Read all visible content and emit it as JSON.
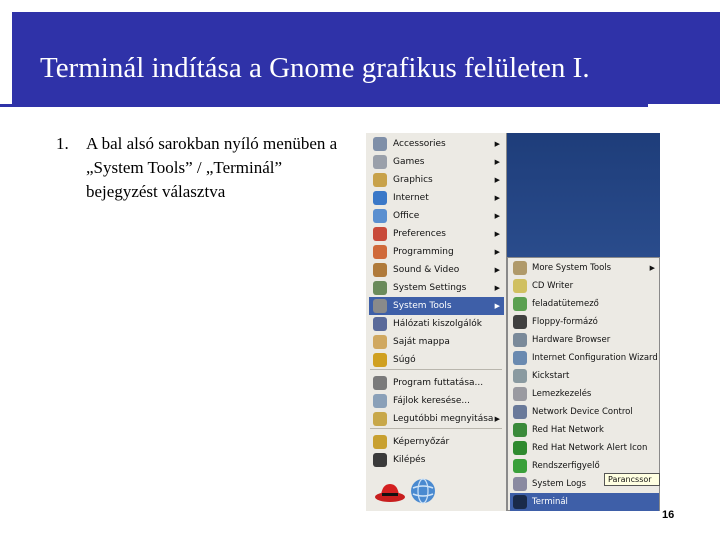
{
  "slide": {
    "title": "Terminál indítása a Gnome grafikus felületen I.",
    "bullet_number": "1.",
    "bullet_text": "A bal alsó sarokban nyíló menüben a „System Tools” / „Terminál” bejegyzést választva",
    "page_number": "16"
  },
  "main_menu": {
    "items": [
      {
        "label": "Accessories",
        "icon": "accessories-icon",
        "color": "#7f8fa8",
        "submenu": true
      },
      {
        "label": "Games",
        "icon": "games-icon",
        "color": "#9aa0aa",
        "submenu": true
      },
      {
        "label": "Graphics",
        "icon": "graphics-icon",
        "color": "#c8a24a",
        "submenu": true
      },
      {
        "label": "Internet",
        "icon": "internet-icon",
        "color": "#3a78c8",
        "submenu": true
      },
      {
        "label": "Office",
        "icon": "office-icon",
        "color": "#5a8fd0",
        "submenu": true
      },
      {
        "label": "Preferences",
        "icon": "preferences-icon",
        "color": "#c84a3a",
        "submenu": true
      },
      {
        "label": "Programming",
        "icon": "programming-icon",
        "color": "#d06a3a",
        "submenu": true
      },
      {
        "label": "Sound & Video",
        "icon": "sound-video-icon",
        "color": "#b07a3a",
        "submenu": true
      },
      {
        "label": "System Settings",
        "icon": "system-settings-icon",
        "color": "#6a8a5a",
        "submenu": true
      },
      {
        "label": "System Tools",
        "icon": "system-tools-icon",
        "color": "#8a8a8a",
        "submenu": true,
        "selected": true
      },
      {
        "label": "Hálózati kiszolgálók",
        "icon": "network-servers-icon",
        "color": "#5a6a9a",
        "submenu": false
      },
      {
        "label": "Saját mappa",
        "icon": "home-folder-icon",
        "color": "#d0a860",
        "submenu": false
      },
      {
        "label": "Súgó",
        "icon": "help-icon",
        "color": "#d0a020",
        "submenu": false
      },
      {
        "label": "Program futtatása...",
        "icon": "run-program-icon",
        "color": "#7a7a7a",
        "submenu": false
      },
      {
        "label": "Fájlok keresése...",
        "icon": "search-files-icon",
        "color": "#8aa0b8",
        "submenu": false
      },
      {
        "label": "Legutóbbi megnyitása",
        "icon": "recent-documents-icon",
        "color": "#c8a84a",
        "submenu": true
      },
      {
        "label": "Képernyőzár",
        "icon": "lock-screen-icon",
        "color": "#c8a030",
        "submenu": false
      },
      {
        "label": "Kilépés",
        "icon": "logout-icon",
        "color": "#3a3a3a",
        "submenu": false
      }
    ]
  },
  "sub_menu": {
    "items": [
      {
        "label": "More System Tools",
        "icon": "more-tools-icon",
        "color": "#b09a6a",
        "submenu": true
      },
      {
        "label": "CD Writer",
        "icon": "cd-writer-icon",
        "color": "#d0c060",
        "submenu": false
      },
      {
        "label": "feladatütemező",
        "icon": "scheduler-icon",
        "color": "#5aa050",
        "submenu": false
      },
      {
        "label": "Floppy-formázó",
        "icon": "floppy-icon",
        "color": "#404040",
        "submenu": false
      },
      {
        "label": "Hardware Browser",
        "icon": "hardware-browser-icon",
        "color": "#7a8a9a",
        "submenu": false
      },
      {
        "label": "Internet Configuration Wizard",
        "icon": "internet-wizard-icon",
        "color": "#6a8ab0",
        "submenu": false
      },
      {
        "label": "Kickstart",
        "icon": "kickstart-icon",
        "color": "#8a9aa0",
        "submenu": false
      },
      {
        "label": "Lemezkezelés",
        "icon": "disk-management-icon",
        "color": "#9a9aa0",
        "submenu": false
      },
      {
        "label": "Network Device Control",
        "icon": "network-device-icon",
        "color": "#6a7a9a",
        "submenu": false
      },
      {
        "label": "Red Hat Network",
        "icon": "redhat-network-icon",
        "color": "#3a8a3a",
        "submenu": false
      },
      {
        "label": "Red Hat Network Alert Icon",
        "icon": "alert-icon",
        "color": "#2f8a2f",
        "submenu": false
      },
      {
        "label": "Rendszerfigyelő",
        "icon": "system-monitor-icon",
        "color": "#3aa03a",
        "submenu": false
      },
      {
        "label": "System Logs",
        "icon": "system-logs-icon",
        "color": "#8a8aa0",
        "submenu": false
      },
      {
        "label": "Terminál",
        "icon": "terminal-icon",
        "color": "#1a2a4a",
        "submenu": false,
        "selected": true
      }
    ]
  },
  "tooltip": "Parancssor"
}
